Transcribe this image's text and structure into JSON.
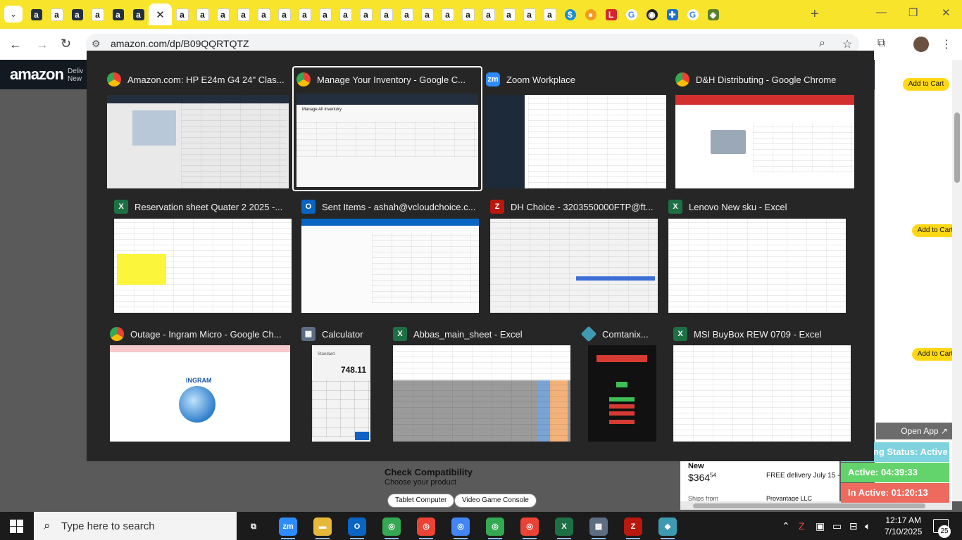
{
  "browser": {
    "url": "amazon.com/dp/B09QQRTQTZ",
    "tabs": [
      {
        "icon": "a",
        "kind": "amz-dark"
      },
      {
        "icon": "a",
        "kind": "amz"
      },
      {
        "icon": "a",
        "kind": "amz-dark"
      },
      {
        "icon": "a",
        "kind": "amz"
      },
      {
        "icon": "a",
        "kind": "amz-dark"
      },
      {
        "icon": "a",
        "kind": "amz-dark"
      },
      {
        "icon": "a",
        "kind": "amz"
      },
      {
        "icon": "a",
        "kind": "amz"
      },
      {
        "icon": "a",
        "kind": "amz"
      },
      {
        "icon": "a",
        "kind": "amz"
      },
      {
        "icon": "a",
        "kind": "amz"
      },
      {
        "icon": "a",
        "kind": "amz"
      },
      {
        "icon": "a",
        "kind": "amz"
      },
      {
        "icon": "a",
        "kind": "amz"
      },
      {
        "icon": "a",
        "kind": "amz"
      },
      {
        "icon": "a",
        "kind": "amz"
      },
      {
        "icon": "a",
        "kind": "amz"
      },
      {
        "icon": "a",
        "kind": "amz"
      },
      {
        "icon": "a",
        "kind": "amz"
      },
      {
        "icon": "a",
        "kind": "amz"
      },
      {
        "icon": "a",
        "kind": "amz"
      },
      {
        "icon": "a",
        "kind": "amz"
      },
      {
        "icon": "a",
        "kind": "amz"
      },
      {
        "icon": "a",
        "kind": "amz"
      },
      {
        "icon": "a",
        "kind": "amz"
      },
      {
        "icon": "$",
        "kind": "s"
      },
      {
        "icon": "●",
        "kind": "o"
      },
      {
        "icon": "L",
        "kind": "l"
      },
      {
        "icon": "G",
        "kind": "g"
      },
      {
        "icon": "◉",
        "kind": "dk"
      },
      {
        "icon": "✚",
        "kind": "bl"
      },
      {
        "icon": "G",
        "kind": "g"
      },
      {
        "icon": "◈",
        "kind": "sh"
      }
    ],
    "active_tab_close": "✕"
  },
  "amazon_page": {
    "logo": "amazon",
    "deliver_line1": "Deliv",
    "deliver_line2": "New",
    "add_to_cart": "Add to Cart",
    "check_compat_title": "Check Compatibility",
    "check_compat_sub": "Choose your product",
    "chips": [
      "Tablet Computer",
      "Video Game Console"
    ],
    "offer_condition": "New",
    "offer_price": "$364",
    "offer_price_cents": "54",
    "offer_delivery": "FREE delivery July 15 - 1",
    "ships_from_label": "Ships from",
    "ships_from_value": "Provantage LLC"
  },
  "status_widget": {
    "open_app": "Open App ↗",
    "working": "Working Status: Active",
    "active": "Active: 04:39:33",
    "inactive": "In Active: 01:20:13"
  },
  "task_switcher": {
    "windows": [
      {
        "title": "Amazon.com: HP E24m G4 24\" Clas...",
        "app": "chrome"
      },
      {
        "title": "Manage Your Inventory - Google C...",
        "app": "chrome",
        "selected": true
      },
      {
        "title": "Zoom Workplace",
        "app": "zoom",
        "app_label": "zm"
      },
      {
        "title": "D&H Distributing - Google Chrome",
        "app": "chrome"
      },
      {
        "title": "Reservation sheet Quater 2 2025 -...",
        "app": "excel",
        "app_label": "X"
      },
      {
        "title": "Sent Items - ashah@vcloudchoice.c...",
        "app": "outlook",
        "app_label": "O"
      },
      {
        "title": "DH Choice - 3203550000FTP@ft...",
        "app": "filezilla",
        "app_label": "Z"
      },
      {
        "title": "Lenovo New sku - Excel",
        "app": "excel",
        "app_label": "X"
      },
      {
        "title": "Outage - Ingram Micro - Google Ch...",
        "app": "chrome"
      },
      {
        "title": "Calculator",
        "app": "calculator",
        "app_label": "▦"
      },
      {
        "title": "Abbas_main_sheet - Excel",
        "app": "excel",
        "app_label": "X"
      },
      {
        "title": "Comtanix...",
        "app": "comtanix",
        "app_label": ""
      },
      {
        "title": "MSI BuyBox REW 0709 - Excel",
        "app": "excel",
        "app_label": "X"
      }
    ],
    "calculator_value": "748.11",
    "calculator_mode": "Standard",
    "ingram_logo": "INGRAM"
  },
  "taskbar": {
    "search_placeholder": "Type here to search",
    "apps": [
      {
        "name": "task-view",
        "label": "⧉",
        "color": "#1b1b1b"
      },
      {
        "name": "zoom",
        "label": "zm",
        "color": "#2d8cff"
      },
      {
        "name": "file-explorer",
        "label": "▬",
        "color": "#e8b83a"
      },
      {
        "name": "outlook",
        "label": "O",
        "color": "#0a64c2"
      },
      {
        "name": "chrome-1",
        "label": "◎",
        "color": "#34a853"
      },
      {
        "name": "chrome-2",
        "label": "◎",
        "color": "#ea4335"
      },
      {
        "name": "chrome-3",
        "label": "◎",
        "color": "#4285f4"
      },
      {
        "name": "chrome-4",
        "label": "◎",
        "color": "#34a853"
      },
      {
        "name": "chrome-5",
        "label": "◎",
        "color": "#ea4335"
      },
      {
        "name": "excel",
        "label": "X",
        "color": "#1d7044"
      },
      {
        "name": "calculator",
        "label": "▦",
        "color": "#5d6e82"
      },
      {
        "name": "filezilla",
        "label": "Z",
        "color": "#b8180e"
      },
      {
        "name": "comtanix",
        "label": "◆",
        "color": "#3e9ab1"
      }
    ],
    "time": "12:17 AM",
    "date": "7/10/2025",
    "notification_count": "25"
  }
}
